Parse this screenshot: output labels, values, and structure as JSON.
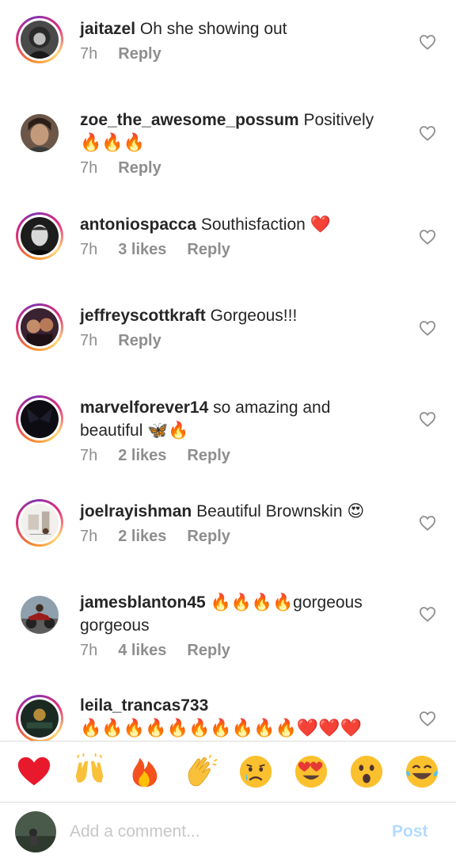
{
  "comments": [
    {
      "username": "jaitazel",
      "text": "Oh she showing out",
      "time": "7h",
      "likes": "",
      "reply": "Reply"
    },
    {
      "username": "zoe_the_awesome_possum",
      "text": "Positively",
      "emoji_line": "🔥🔥🔥",
      "time": "7h",
      "likes": "",
      "reply": "Reply"
    },
    {
      "username": "antoniospacca",
      "text": "Southisfaction ❤️",
      "time": "7h",
      "likes": "3 likes",
      "reply": "Reply"
    },
    {
      "username": "jeffreyscottkraft",
      "text": "Gorgeous!!!",
      "time": "7h",
      "likes": "",
      "reply": "Reply"
    },
    {
      "username": "marvelforever14",
      "text": "so amazing and beautiful 🦋🔥",
      "time": "7h",
      "likes": "2 likes",
      "reply": "Reply"
    },
    {
      "username": "joelrayishman",
      "text": "Beautiful Brownskin 😍",
      "time": "7h",
      "likes": "2 likes",
      "reply": "Reply"
    },
    {
      "username": "jamesblanton45",
      "text": "🔥🔥🔥🔥gorgeous gorgeous",
      "time": "7h",
      "likes": "4 likes",
      "reply": "Reply"
    },
    {
      "username": "leila_trancas733",
      "text": "🔥🔥🔥🔥🔥🔥🔥🔥🔥🔥❤️❤️❤️",
      "time": "",
      "likes": "",
      "reply": ""
    }
  ],
  "reactions": [
    "red-heart",
    "raising-hands",
    "fire",
    "clapping-hands",
    "crying-face",
    "heart-eyes",
    "surprised-face",
    "tears-of-joy"
  ],
  "composer": {
    "placeholder": "Add a comment...",
    "post_label": "Post"
  },
  "colors": {
    "text": "#262626",
    "meta": "#8e8e8e",
    "post_disabled": "#b3dbff",
    "placeholder": "#c7c7c7",
    "divider": "#dbdbdb"
  }
}
